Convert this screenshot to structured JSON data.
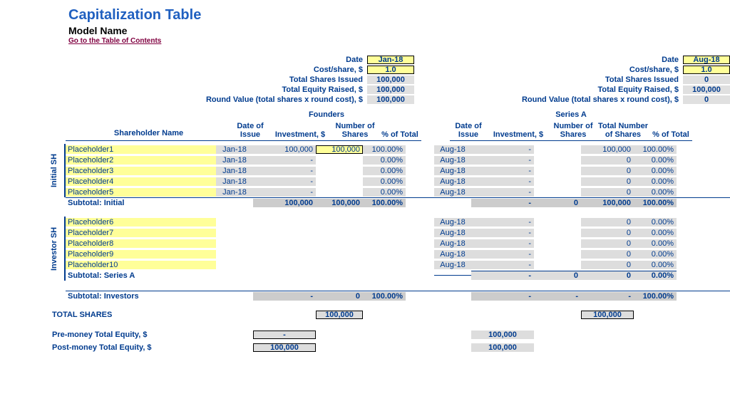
{
  "header": {
    "title": "Capitalization Table",
    "model_name": "Model Name",
    "toc_link": "Go to the Table of Contents"
  },
  "rounds": {
    "founders": {
      "label": "Founders",
      "meta": {
        "date_label": "Date",
        "date_value": "Jan-18",
        "cost_label": "Cost/share, $",
        "cost_value": "1.0",
        "shares_label": "Total Shares Issued",
        "shares_value": "100,000",
        "equity_label": "Total Equity Raised, $",
        "equity_value": "100,000",
        "roundval_label": "Round Value (total shares x round cost), $",
        "roundval_value": "100,000"
      },
      "cols": {
        "date": "Date of Issue",
        "investment": "Investment, $",
        "shares": "Number of Shares",
        "pct": "% of Total"
      }
    },
    "seriesA": {
      "label": "Series A",
      "meta": {
        "date_label": "Date",
        "date_value": "Aug-18",
        "cost_label": "Cost/share, $",
        "cost_value": "1.0",
        "shares_label": "Total Shares Issued",
        "shares_value": "0",
        "equity_label": "Total Equity Raised, $",
        "equity_value": "100,000",
        "roundval_label": "Round Value (total shares x round cost), $",
        "roundval_value": "0"
      },
      "cols": {
        "date": "Date of Issue",
        "investment": "Investment, $",
        "shares": "Number of Shares",
        "total_shares": "Total Number of Shares",
        "pct": "% of Total"
      }
    }
  },
  "labels": {
    "shareholder_header": "Shareholder Name",
    "section_initial": "Initial SH",
    "section_investor": "Investor SH",
    "subtotal_initial": "Subtotal: Initial",
    "subtotal_seriesA": "Subtotal: Series A",
    "subtotal_investors": "Subtotal: Investors",
    "total_shares": "TOTAL SHARES",
    "pre_money": "Pre-money Total Equity, $",
    "post_money": "Post-money Total Equity, $"
  },
  "initial_rows": [
    {
      "name": "Placeholder1",
      "f_date": "Jan-18",
      "f_inv": "100,000",
      "f_sh": "100,000",
      "f_pct": "100.00%",
      "a_date": "Aug-18",
      "a_inv": "-",
      "a_sh": "",
      "a_tot": "100,000",
      "a_pct": "100.00%"
    },
    {
      "name": "Placeholder2",
      "f_date": "Jan-18",
      "f_inv": "-",
      "f_sh": "",
      "f_pct": "0.00%",
      "a_date": "Aug-18",
      "a_inv": "-",
      "a_sh": "",
      "a_tot": "0",
      "a_pct": "0.00%"
    },
    {
      "name": "Placeholder3",
      "f_date": "Jan-18",
      "f_inv": "-",
      "f_sh": "",
      "f_pct": "0.00%",
      "a_date": "Aug-18",
      "a_inv": "-",
      "a_sh": "",
      "a_tot": "0",
      "a_pct": "0.00%"
    },
    {
      "name": "Placeholder4",
      "f_date": "Jan-18",
      "f_inv": "-",
      "f_sh": "",
      "f_pct": "0.00%",
      "a_date": "Aug-18",
      "a_inv": "-",
      "a_sh": "",
      "a_tot": "0",
      "a_pct": "0.00%"
    },
    {
      "name": "Placeholder5",
      "f_date": "Jan-18",
      "f_inv": "-",
      "f_sh": "",
      "f_pct": "0.00%",
      "a_date": "Aug-18",
      "a_inv": "-",
      "a_sh": "",
      "a_tot": "0",
      "a_pct": "0.00%"
    }
  ],
  "subtotal_initial": {
    "f_inv": "100,000",
    "f_sh": "100,000",
    "f_pct": "100.00%",
    "a_inv": "-",
    "a_sh": "0",
    "a_tot": "100,000",
    "a_pct": "100.00%"
  },
  "investor_rows": [
    {
      "name": "Placeholder6",
      "a_date": "Aug-18",
      "a_inv": "-",
      "a_sh": "",
      "a_tot": "0",
      "a_pct": "0.00%"
    },
    {
      "name": "Placeholder7",
      "a_date": "Aug-18",
      "a_inv": "-",
      "a_sh": "",
      "a_tot": "0",
      "a_pct": "0.00%"
    },
    {
      "name": "Placeholder8",
      "a_date": "Aug-18",
      "a_inv": "-",
      "a_sh": "",
      "a_tot": "0",
      "a_pct": "0.00%"
    },
    {
      "name": "Placeholder9",
      "a_date": "Aug-18",
      "a_inv": "-",
      "a_sh": "",
      "a_tot": "0",
      "a_pct": "0.00%"
    },
    {
      "name": "Placeholder10",
      "a_date": "Aug-18",
      "a_inv": "-",
      "a_sh": "",
      "a_tot": "0",
      "a_pct": "0.00%"
    }
  ],
  "subtotal_seriesA": {
    "a_inv": "-",
    "a_sh": "0",
    "a_tot": "0",
    "a_pct": "0.00%"
  },
  "subtotal_investors": {
    "f_inv": "-",
    "f_sh": "0",
    "f_pct": "100.00%",
    "a_inv": "-",
    "a_sh": "-",
    "a_tot": "-",
    "a_pct": "100.00%"
  },
  "totals": {
    "total_shares_f": "100,000",
    "total_shares_a": "100,000",
    "pre_money_f": "-",
    "pre_money_a": "100,000",
    "post_money_f": "100,000",
    "post_money_a": "100,000"
  }
}
